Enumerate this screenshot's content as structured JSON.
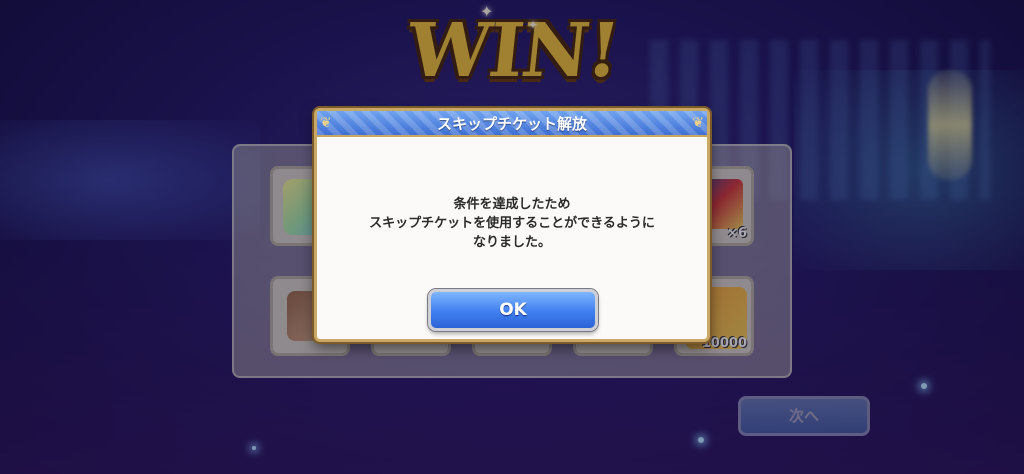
{
  "win_logo": {
    "text": "WIN!"
  },
  "dialog": {
    "title": "スキップチケット解放",
    "message": [
      "条件を達成したため",
      "スキップチケットを使用することができるように",
      "なりました。"
    ],
    "ok_label": "OK"
  },
  "rewards": [
    {
      "icon": "gem-icon",
      "count": ""
    },
    {
      "icon": "gold-medal-icon",
      "count": "×6"
    },
    {
      "icon": "shoe-icon",
      "count": ""
    },
    {
      "icon": "card-icon",
      "count": ""
    },
    {
      "icon": "card-icon",
      "count": ""
    },
    {
      "icon": "card-icon",
      "count": ""
    },
    {
      "icon": "coin-icon",
      "count": "10000"
    }
  ],
  "next_button": {
    "label": "次へ"
  },
  "colors": {
    "dialog_header": "#3e6fd4",
    "dialog_border": "#c9a865",
    "ok_button": "#3f7ff0",
    "win_gold": "#f0c43a"
  }
}
